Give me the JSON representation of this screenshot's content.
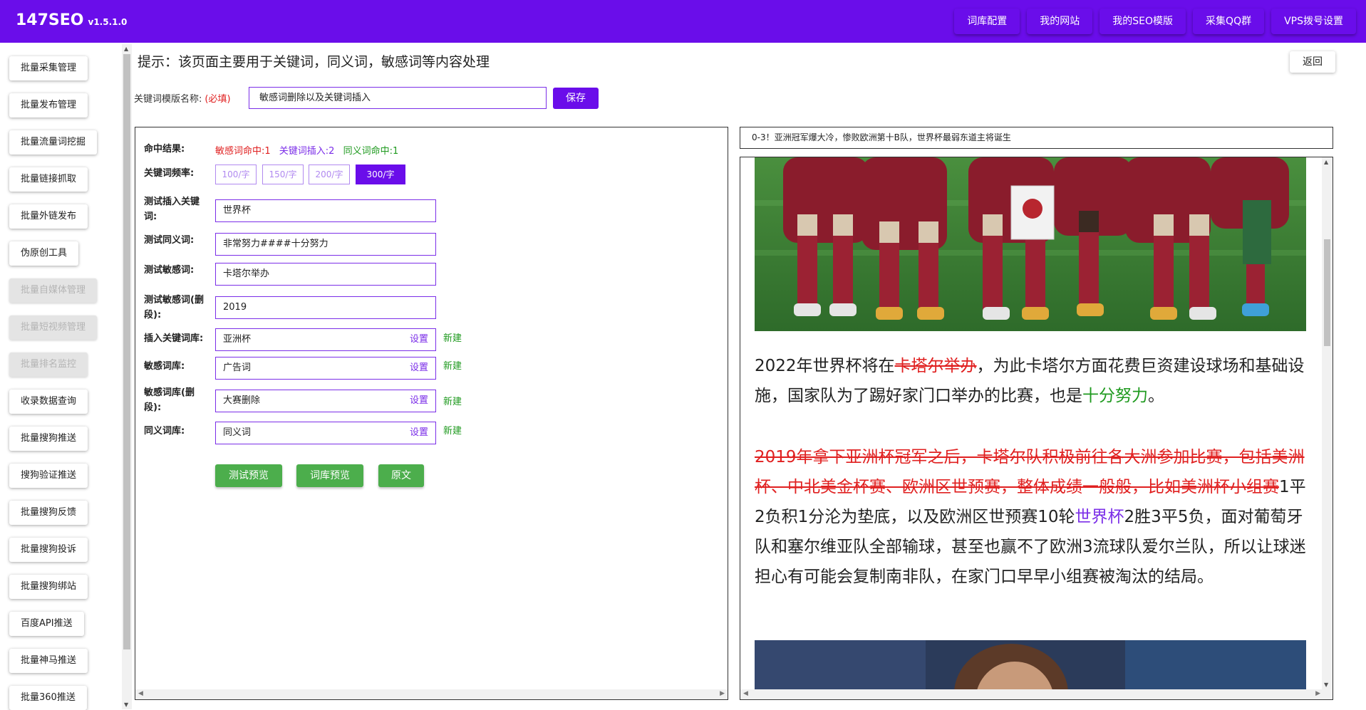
{
  "header": {
    "brand": "147SEO",
    "version": "v1.5.1.0",
    "nav": [
      "词库配置",
      "我的网站",
      "我的SEO模版",
      "采集QQ群",
      "VPS拨号设置"
    ]
  },
  "sidebar": {
    "items": [
      {
        "label": "批量采集管理",
        "disabled": false
      },
      {
        "label": "批量发布管理",
        "disabled": false
      },
      {
        "label": "批量流量词挖掘",
        "disabled": false
      },
      {
        "label": "批量链接抓取",
        "disabled": false
      },
      {
        "label": "批量外链发布",
        "disabled": false
      },
      {
        "label": "伪原创工具",
        "disabled": false
      },
      {
        "label": "批量自媒体管理",
        "disabled": true
      },
      {
        "label": "批量短视频管理",
        "disabled": true
      },
      {
        "label": "批量排名监控",
        "disabled": true
      },
      {
        "label": "收录数据查询",
        "disabled": false
      },
      {
        "label": "批量搜狗推送",
        "disabled": false
      },
      {
        "label": "搜狗验证推送",
        "disabled": false
      },
      {
        "label": "批量搜狗反馈",
        "disabled": false
      },
      {
        "label": "批量搜狗投诉",
        "disabled": false
      },
      {
        "label": "批量搜狗绑站",
        "disabled": false
      },
      {
        "label": "百度API推送",
        "disabled": false
      },
      {
        "label": "批量神马推送",
        "disabled": false
      },
      {
        "label": "批量360推送",
        "disabled": false
      }
    ]
  },
  "page": {
    "hint": "提示：该页面主要用于关键词，同义词，敏感词等内容处理",
    "back_label": "返回",
    "name_label": "关键词模版名称:",
    "required_mark": "(必填)",
    "name_value": "敏感词删除以及关键词插入",
    "save_label": "保存"
  },
  "form": {
    "hit_label": "命中结果:",
    "hits": {
      "sensitive": "敏感词命中:1",
      "keyword": "关键词插入:2",
      "synonym": "同义词命中:1"
    },
    "freq_label": "关键词频率:",
    "freq_options": [
      "100/字",
      "150/字",
      "200/字",
      "300/字"
    ],
    "freq_selected": "300/字",
    "test_keyword_label": "测试插入关键词:",
    "test_keyword_value": "世界杯",
    "test_synonym_label": "测试同义词:",
    "test_synonym_value": "非常努力####十分努力",
    "test_sensitive_label": "测试敏感词:",
    "test_sensitive_value": "卡塔尔举办",
    "test_sensitive_del_label": "测试敏感词(删段):",
    "test_sensitive_del_value": "2019",
    "kw_lib_label": "插入关键词库:",
    "kw_lib_value": "亚洲杯",
    "sens_lib_label": "敏感词库:",
    "sens_lib_value": "广告词",
    "sens_del_lib_label": "敏感词库(删段):",
    "sens_del_lib_value": "大赛删除",
    "syn_lib_label": "同义词库:",
    "syn_lib_value": "同义词",
    "set_label": "设置",
    "new_label": "新建",
    "buttons": [
      "测试预览",
      "词库预览",
      "原文"
    ]
  },
  "preview": {
    "title": "0-3！亚洲冠军爆大冷，惨败欧洲第十B队，世界杯最弱东道主将诞生",
    "p1": {
      "a": "2022年世界杯将在",
      "strike": "卡塔尔举办",
      "b": "，为此卡塔尔方面花费巨资建设球场和基础设施，国家队为了踢好家门口举办的比赛，也是",
      "syn": "十分努力",
      "c": "。"
    },
    "p2": {
      "strike": "2019年拿下亚洲杯冠军之后，卡塔尔队积极前往各大洲参加比赛，包括美洲杯、中北美金杯赛、欧洲区世预赛，整体成绩一般般，比如美洲杯小组赛",
      "a": "1平2负积1分沦为垫底，以及欧洲区世预赛10轮",
      "kw": "世界杯",
      "b": "2胜3平5负，面对葡萄牙队和塞尔维亚队全部输球，甚至也赢不了欧洲3流球队爱尔兰队，所以让球迷担心有可能会复制南非队，在家门口早早小组赛被淘汰的结局。"
    }
  },
  "colors": {
    "brand": "#6a0dea",
    "sensitive": "#e02020",
    "synonym": "#1f9a1f",
    "keyword": "#7b2ee8",
    "action_green": "#4cae4c"
  }
}
